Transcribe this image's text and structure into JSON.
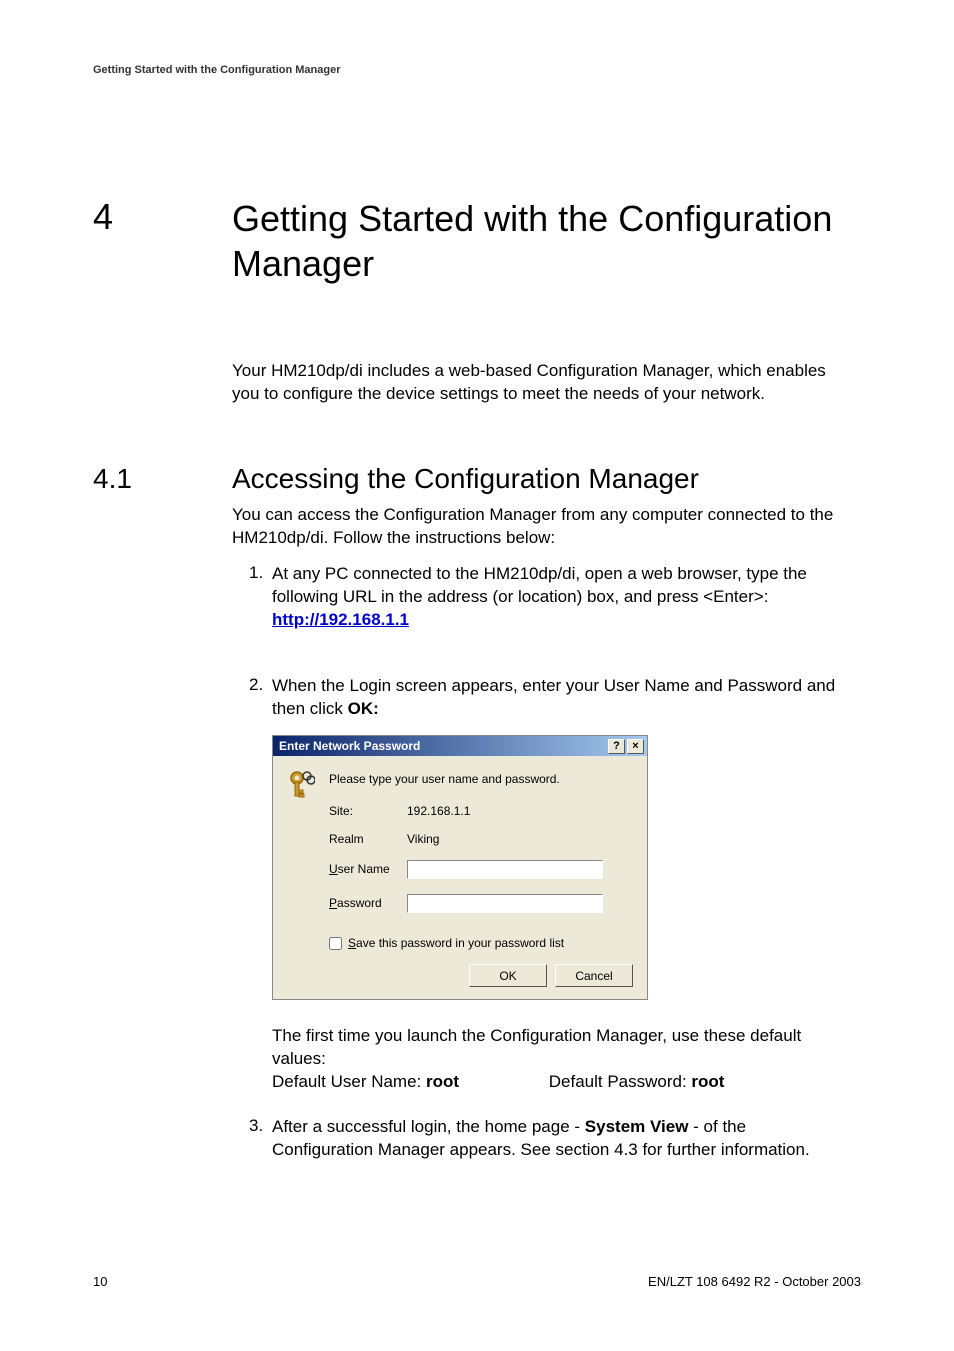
{
  "header": "Getting Started with the Configuration Manager",
  "chapter_num": "4",
  "chapter_title": "Getting Started with the Configuration Manager",
  "intro": "Your HM210dp/di includes a web-based Configuration Manager, which enables you to configure the device settings to meet the needs of your network.",
  "section_num": "4.1",
  "section_title": "Accessing the Configuration Manager",
  "section_intro": "You can access the Configuration Manager from any computer connected to the HM210dp/di. Follow the instructions below:",
  "step1_num": "1.",
  "step1_a": "At any PC connected to the HM210dp/di, open a web browser, type the following URL in the address (or location) box, and press <Enter>:",
  "step1_link": "http://192.168.1.1",
  "step2_num": "2.",
  "step2_a": "When the Login screen appears, enter your User Name and Password and then click ",
  "step2_b_bold": "OK:",
  "dialog": {
    "title": "Enter Network Password",
    "help_btn": "?",
    "close_btn": "×",
    "prompt": "Please type your user name and password.",
    "site_label": "Site:",
    "site_value": "192.168.1.1",
    "realm_label": "Realm",
    "realm_value": "Viking",
    "user_u": "U",
    "user_rest": "ser Name",
    "pass_u": "P",
    "pass_rest": "assword",
    "cb_s": "S",
    "cb_rest": "ave this password in your password list",
    "ok": "OK",
    "cancel": "Cancel"
  },
  "post1": "The first time you launch the Configuration Manager, use these default values:",
  "post2a": "Default User Name: ",
  "post2a_bold": "root",
  "post2b": "Default Password: ",
  "post2b_bold": "root",
  "step3_num": "3.",
  "step3_a": "After a successful login, the home page - ",
  "step3_bold": "System View",
  "step3_b": " - of the Configuration Manager appears. See section 4.3 for further information.",
  "page_num": "10",
  "doc_ref": "EN/LZT 108 6492 R2  - October 2003"
}
